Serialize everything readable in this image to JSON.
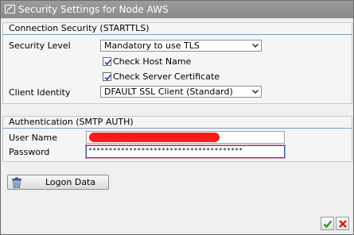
{
  "window": {
    "title": "Security Settings for Node AWS"
  },
  "connection_security": {
    "heading": "Connection Security (STARTTLS)",
    "security_level_label": "Security Level",
    "security_level_value": "Mandatory to use TLS",
    "check_host_name_label": "Check Host Name",
    "check_host_name_checked": true,
    "check_server_certificate_label": "Check Server Certificate",
    "check_server_certificate_checked": true,
    "client_identity_label": "Client Identity",
    "client_identity_value": "DFAULT SSL Client (Standard)"
  },
  "authentication": {
    "heading": "Authentication (SMTP AUTH)",
    "user_name_label": "User Name",
    "user_name_value_redacted": true,
    "password_label": "Password",
    "password_value": "**************************************"
  },
  "logon_data_button": {
    "label": "Logon Data",
    "icon": "trash-icon"
  },
  "footer": {
    "confirm_icon": "check-icon",
    "cancel_icon": "close-icon",
    "confirm_color": "#2e9a2e",
    "cancel_color": "#d42020"
  }
}
